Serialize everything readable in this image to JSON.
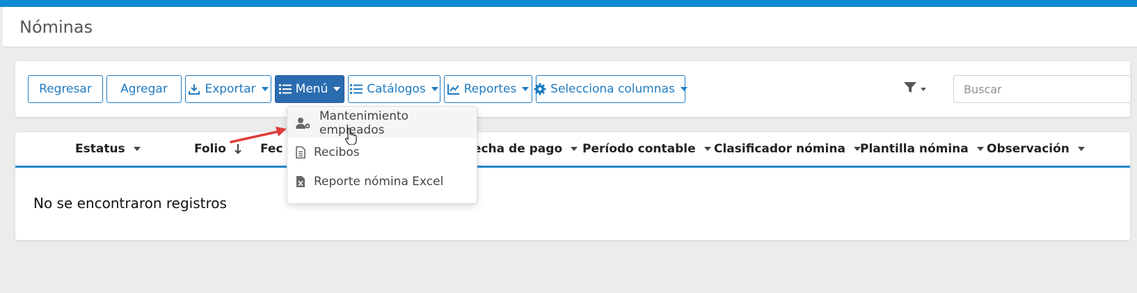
{
  "page": {
    "title": "Nóminas"
  },
  "toolbar": {
    "regresar": "Regresar",
    "agregar": "Agregar",
    "exportar": "Exportar",
    "menu": "Menú",
    "catalogos": "Catálogos",
    "reportes": "Reportes",
    "columnas": "Selecciona columnas",
    "search_placeholder": "Buscar"
  },
  "table": {
    "columns": [
      "Estatus",
      "Folio",
      "Fec",
      "Fecha de pago",
      "Período contable",
      "Clasificador nómina",
      "Plantilla nómina",
      "Observación"
    ],
    "empty_message": "No se encontraron registros"
  },
  "menu_dropdown": {
    "items": [
      "Mantenimiento empleados",
      "Recibos",
      "Reporte nómina Excel"
    ]
  },
  "colors": {
    "accent": "#1f7bc1",
    "topbar": "#0a8bd2",
    "active_button": "#2b6cb0",
    "arrow": "#e03c3c"
  }
}
